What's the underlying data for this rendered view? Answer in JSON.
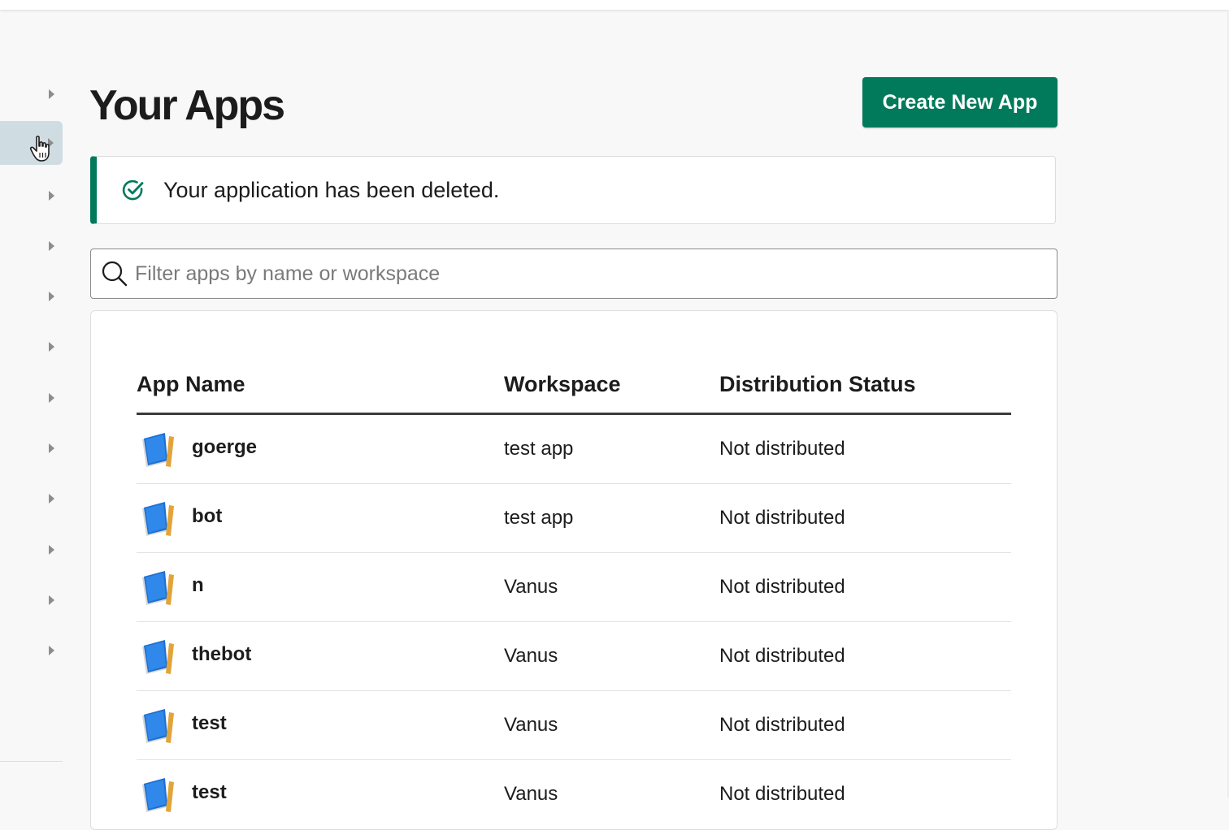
{
  "page": {
    "title": "Your Apps",
    "create_button_label": "Create New App"
  },
  "alert": {
    "message": "Your application has been deleted.",
    "icon": "check-circle-icon",
    "color": "#007a5a"
  },
  "search": {
    "placeholder": "Filter apps by name or workspace",
    "value": ""
  },
  "table": {
    "headers": {
      "app_name": "App Name",
      "workspace": "Workspace",
      "distribution_status": "Distribution Status"
    },
    "rows": [
      {
        "name": "goerge",
        "workspace": "test app",
        "status": "Not distributed"
      },
      {
        "name": "bot",
        "workspace": "test app",
        "status": "Not distributed"
      },
      {
        "name": "n",
        "workspace": "Vanus",
        "status": "Not distributed"
      },
      {
        "name": "thebot",
        "workspace": "Vanus",
        "status": "Not distributed"
      },
      {
        "name": "test",
        "workspace": "Vanus",
        "status": "Not distributed"
      },
      {
        "name": "test",
        "workspace": "Vanus",
        "status": "Not distributed"
      }
    ]
  },
  "colors": {
    "brand_green": "#007a5a",
    "sidebar_active": "#cfdde3"
  }
}
